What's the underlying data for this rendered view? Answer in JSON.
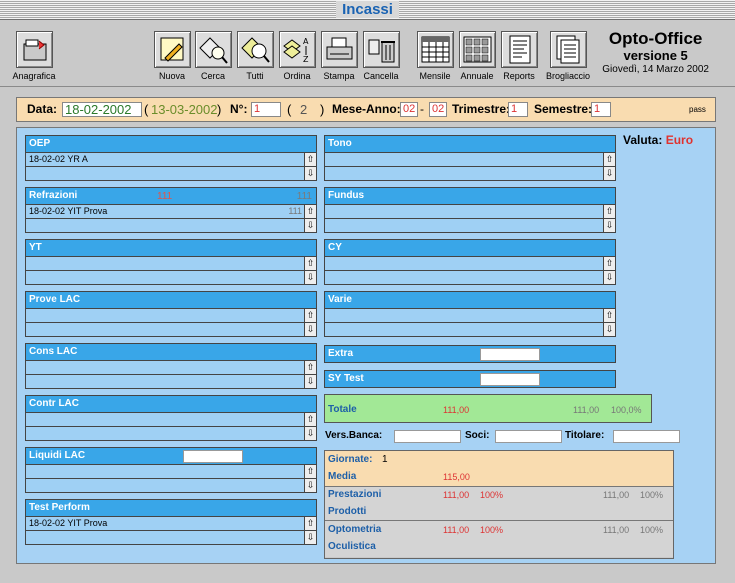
{
  "window": {
    "title": "Incassi"
  },
  "toolbar": {
    "buttons": [
      {
        "label": "Anagrafica",
        "icon": "folder-icon"
      },
      {
        "label": "Nuova",
        "icon": "pencil-icon"
      },
      {
        "label": "Cerca",
        "icon": "magnifier-icon"
      },
      {
        "label": "Tutti",
        "icon": "magnifier-all-icon"
      },
      {
        "label": "Ordina",
        "icon": "sort-az-icon"
      },
      {
        "label": "Stampa",
        "icon": "printer-icon"
      },
      {
        "label": "Cancella",
        "icon": "trash-icon"
      },
      {
        "label": "Mensile",
        "icon": "calendar-month-icon"
      },
      {
        "label": "Annuale",
        "icon": "calendar-year-icon"
      },
      {
        "label": "Reports",
        "icon": "report-icon"
      },
      {
        "label": "Brogliaccio",
        "icon": "pages-icon"
      }
    ]
  },
  "brand": {
    "name": "Opto-Office",
    "version": "versione 5",
    "date": "Giovedì, 14 Marzo 2002"
  },
  "header": {
    "data_label": "Data:",
    "data_value": "18-02-2002",
    "data_secondary": "13-03-2002",
    "open_paren": "(",
    "close_paren": ")",
    "num_label": "N°:",
    "num_value": "1",
    "num_secondary": "2",
    "mese_anno_label": "Mese-Anno:",
    "mese_value": "02",
    "dash": "-",
    "anno_value": "02",
    "trimestre_label": "Trimestre:",
    "trimestre_value": "1",
    "semestre_label": "Semestre:",
    "semestre_value": "1",
    "pass": "pass"
  },
  "valuta": {
    "label": "Valuta:",
    "value": "Euro"
  },
  "left_sections": {
    "oep": {
      "title": "OEP",
      "rows": [
        "18-02-02  YR  A",
        ""
      ]
    },
    "refrazioni": {
      "title": "Refrazioni",
      "header_value": "111",
      "header_value2": "111",
      "rows": [
        "18-02-02  YIT  Prova",
        ""
      ],
      "row_amount": "111"
    },
    "yt": {
      "title": "YT",
      "rows": [
        "",
        ""
      ]
    },
    "prove_lac": {
      "title": "Prove LAC",
      "rows": [
        "",
        ""
      ]
    },
    "cons_lac": {
      "title": "Cons LAC",
      "rows": [
        "",
        ""
      ]
    },
    "contr_lac": {
      "title": "Contr LAC",
      "rows": [
        "",
        ""
      ]
    },
    "liquidi_lac": {
      "title": "Liquidi LAC",
      "rows": [
        "",
        ""
      ]
    },
    "test_perform": {
      "title": "Test Perform",
      "rows": [
        "18-02-02  YIT  Prova",
        ""
      ]
    }
  },
  "right_sections": {
    "tono": {
      "title": "Tono",
      "rows": [
        "",
        ""
      ]
    },
    "fundus": {
      "title": "Fundus",
      "rows": [
        "",
        ""
      ]
    },
    "cy": {
      "title": "CY",
      "rows": [
        "",
        ""
      ]
    },
    "varie": {
      "title": "Varie",
      "rows": [
        "",
        ""
      ]
    },
    "extra": {
      "title": "Extra"
    },
    "sy_test": {
      "title": "SY Test"
    }
  },
  "totale": {
    "label": "Totale",
    "value": "111,00",
    "value2": "111,00",
    "percent": "100,0%"
  },
  "vers": {
    "banca_label": "Vers.Banca:",
    "soci_label": "Soci:",
    "titolare_label": "Titolare:"
  },
  "giornate": {
    "label": "Giornate:",
    "value": "1",
    "media_label": "Media",
    "media_value": "115,00",
    "prestazioni_label": "Prestazioni",
    "prestazioni_value": "111,00",
    "prestazioni_pct": "100%",
    "prestazioni_value2": "111,00",
    "prestazioni_pct2": "100%",
    "prodotti_label": "Prodotti",
    "optometria_label": "Optometria",
    "optometria_value": "111,00",
    "optometria_pct": "100%",
    "optometria_value2": "111,00",
    "optometria_pct2": "100%",
    "oculistica_label": "Oculistica"
  },
  "scroll": {
    "up": "⇧",
    "down": "⇩"
  }
}
